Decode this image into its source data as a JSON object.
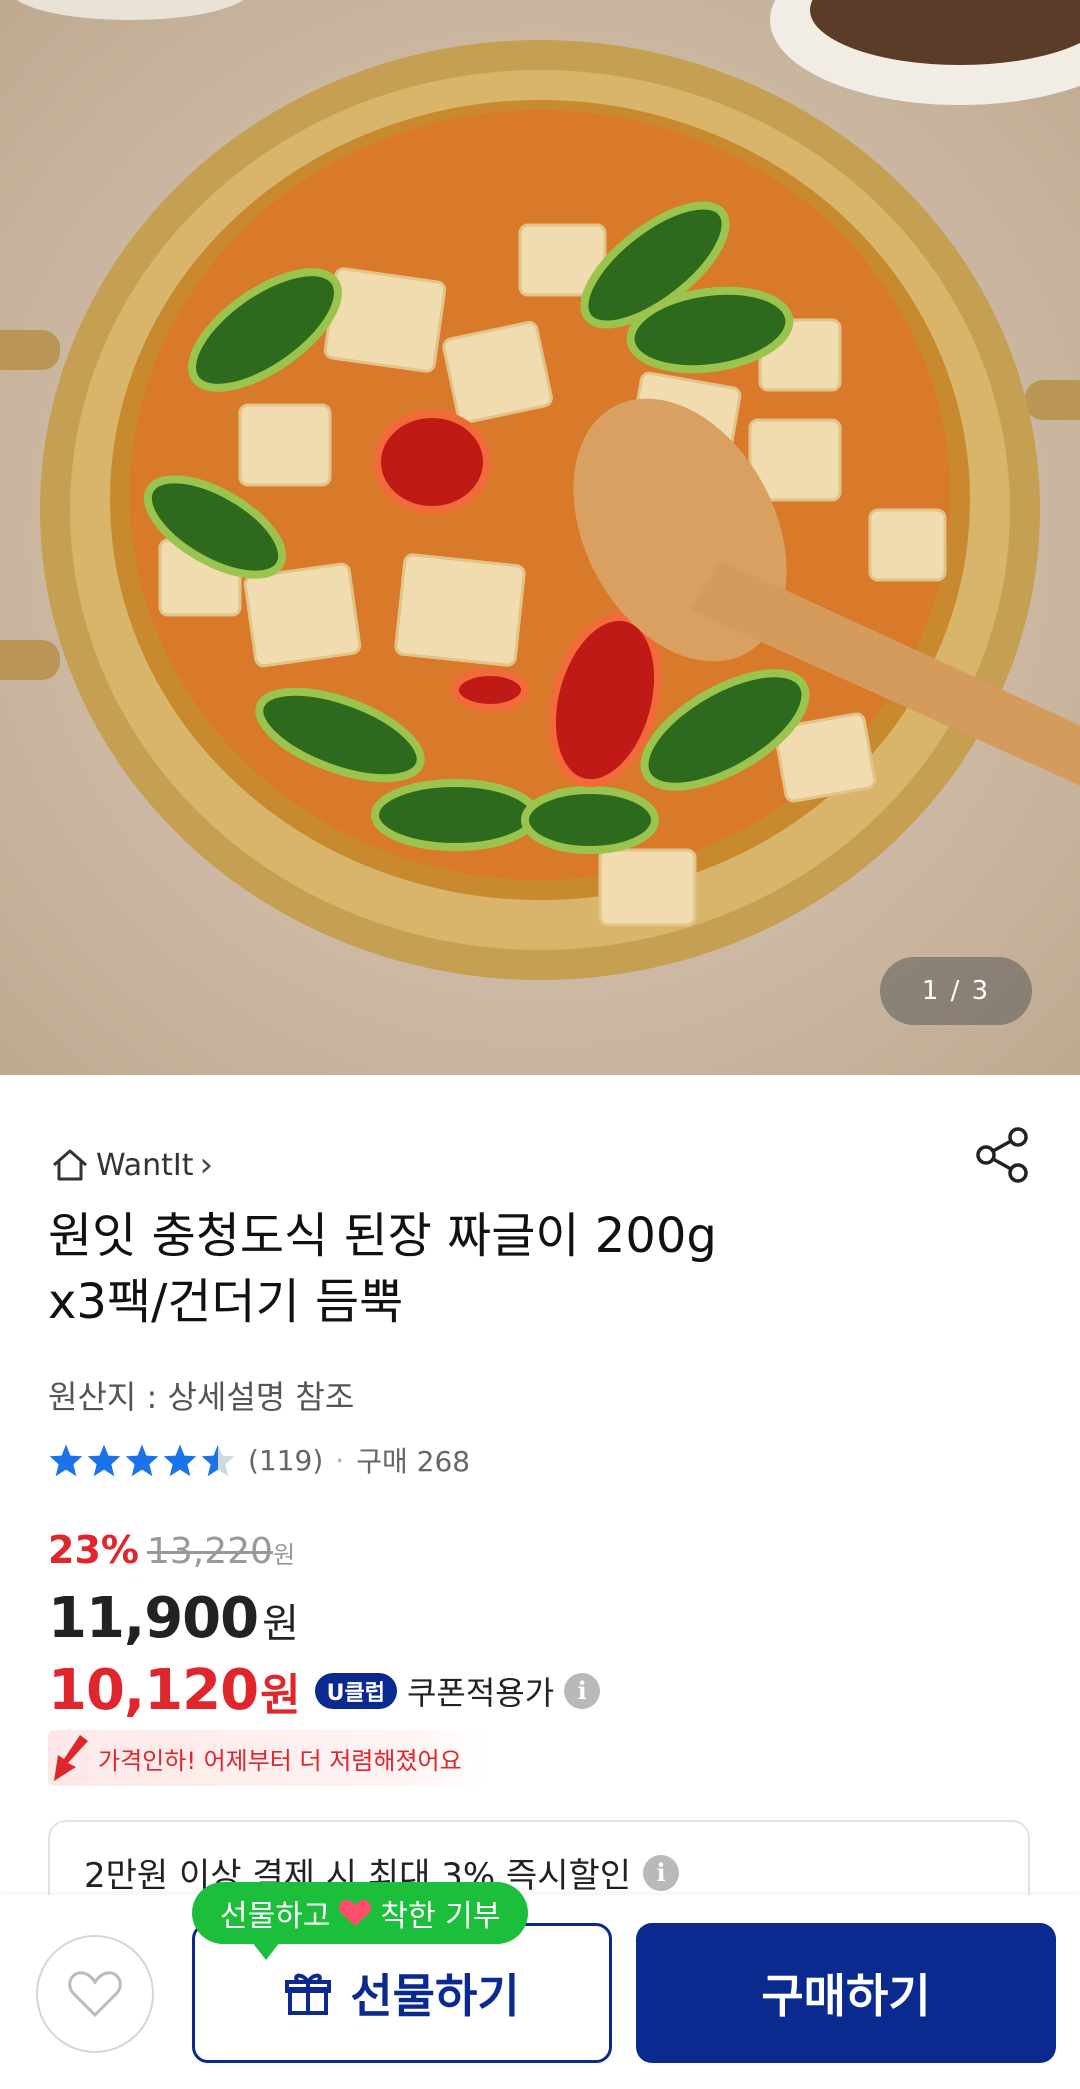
{
  "gallery": {
    "counter": "1 / 3"
  },
  "brand": {
    "name": "WantIt",
    "chevron": "›"
  },
  "product": {
    "title_line1": "원잇 충청도식 된장 짜글이 200g",
    "title_line2": "x3팩/건더기 듬뿍",
    "origin": "원산지 : 상세설명 참조",
    "rating_value": 4.5,
    "review_count": "(119)",
    "purchase_count": "구매 268"
  },
  "pricing": {
    "discount_pct": "23%",
    "original_price": "13,220",
    "original_won": "원",
    "sale_price": "11,900",
    "sale_won": "원",
    "coupon_price": "10,120",
    "coupon_won": "원",
    "uclub_badge": "U클럽",
    "coupon_label": "쿠폰적용가",
    "info_icon": "i",
    "price_drop_text": "가격인하! 어제부터 더 저렴해졌어요"
  },
  "promo": {
    "text": "2만원 이상 결제 시 최대 3% 즉시할인"
  },
  "actions": {
    "bubble_text_1": "선물하고",
    "bubble_text_2": "착한 기부",
    "gift_label": "선물하기",
    "buy_label": "구매하기"
  },
  "colors": {
    "accent_red": "#e0262d",
    "brand_navy": "#0a2a8f",
    "bubble_green": "#1bbf3c"
  },
  "icons": [
    "home-icon",
    "share-icon",
    "star-icon",
    "info-icon",
    "down-arrow-icon",
    "heart-icon",
    "gift-icon"
  ]
}
